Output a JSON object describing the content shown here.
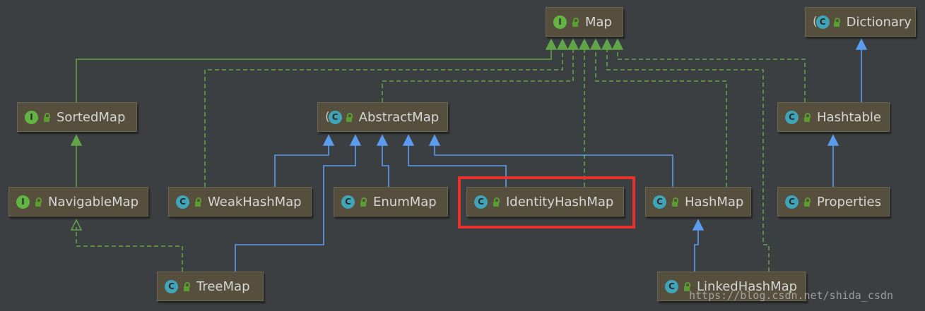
{
  "nodes": [
    {
      "id": "map",
      "name": "Map",
      "kind": "interface"
    },
    {
      "id": "dictionary",
      "name": "Dictionary",
      "kind": "abstract-class"
    },
    {
      "id": "sortedmap",
      "name": "SortedMap",
      "kind": "interface"
    },
    {
      "id": "abstractmap",
      "name": "AbstractMap",
      "kind": "abstract-class"
    },
    {
      "id": "hashtable",
      "name": "Hashtable",
      "kind": "class"
    },
    {
      "id": "navigablemap",
      "name": "NavigableMap",
      "kind": "interface"
    },
    {
      "id": "weakhashmap",
      "name": "WeakHashMap",
      "kind": "class"
    },
    {
      "id": "enummap",
      "name": "EnumMap",
      "kind": "class"
    },
    {
      "id": "identityhashmap",
      "name": "IdentityHashMap",
      "kind": "class"
    },
    {
      "id": "hashmap",
      "name": "HashMap",
      "kind": "class"
    },
    {
      "id": "properties",
      "name": "Properties",
      "kind": "class"
    },
    {
      "id": "treemap",
      "name": "TreeMap",
      "kind": "class"
    },
    {
      "id": "linkedhashmap",
      "name": "LinkedHashMap",
      "kind": "class"
    }
  ],
  "edges": [
    {
      "from": "sortedmap",
      "to": "map",
      "type": "extends-interface"
    },
    {
      "from": "weakhashmap",
      "to": "map",
      "type": "implements"
    },
    {
      "from": "abstractmap",
      "to": "map",
      "type": "implements"
    },
    {
      "from": "identityhashmap",
      "to": "map",
      "type": "implements"
    },
    {
      "from": "hashmap",
      "to": "map",
      "type": "implements"
    },
    {
      "from": "linkedhashmap",
      "to": "map",
      "type": "implements"
    },
    {
      "from": "hashtable",
      "to": "map",
      "type": "implements"
    },
    {
      "from": "hashtable",
      "to": "dictionary",
      "type": "extends-class"
    },
    {
      "from": "properties",
      "to": "hashtable",
      "type": "extends-class"
    },
    {
      "from": "navigablemap",
      "to": "sortedmap",
      "type": "extends-interface"
    },
    {
      "from": "treemap",
      "to": "navigablemap",
      "type": "implements"
    },
    {
      "from": "weakhashmap",
      "to": "abstractmap",
      "type": "extends-class"
    },
    {
      "from": "treemap",
      "to": "abstractmap",
      "type": "extends-class"
    },
    {
      "from": "enummap",
      "to": "abstractmap",
      "type": "extends-class"
    },
    {
      "from": "identityhashmap",
      "to": "abstractmap",
      "type": "extends-class"
    },
    {
      "from": "hashmap",
      "to": "abstractmap",
      "type": "extends-class"
    },
    {
      "from": "linkedhashmap",
      "to": "hashmap",
      "type": "extends-class"
    }
  ],
  "badges": {
    "interface": "I",
    "class": "C",
    "abstract-class": "C"
  },
  "highlighted_node": "identityhashmap",
  "colors": {
    "background": "#3c3f41",
    "node_fill": "#574f3e",
    "interface_line": "#62a548",
    "class_line": "#5c9cee",
    "highlight": "#e8302d"
  },
  "watermark": "https://blog.csdn.net/shida_csdn"
}
